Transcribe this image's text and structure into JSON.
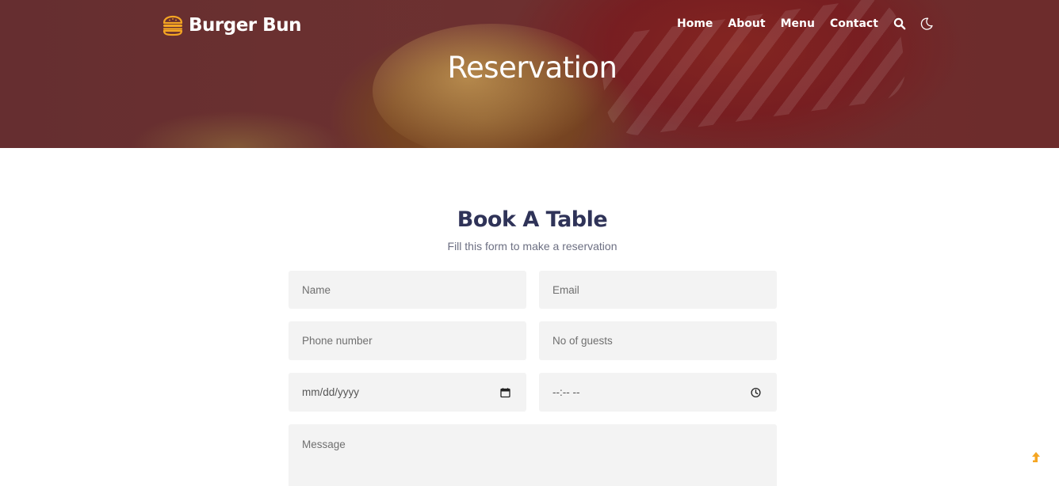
{
  "brand": {
    "name": "Burger Bun",
    "logo_icon": "burger-icon"
  },
  "nav": {
    "links": [
      "Home",
      "About",
      "Menu",
      "Contact"
    ],
    "icons": [
      "search-icon",
      "moon-icon"
    ]
  },
  "hero": {
    "title": "Reservation"
  },
  "form": {
    "title": "Book A Table",
    "subtitle": "Fill this form to make a reservation",
    "name_placeholder": "Name",
    "email_placeholder": "Email",
    "phone_placeholder": "Phone number",
    "guests_placeholder": "No of guests",
    "date_placeholder": "mm/dd/yyyy",
    "time_placeholder": "--:-- --",
    "message_placeholder": "Message"
  },
  "colors": {
    "accent": "#f5a623",
    "title": "#2f3358",
    "field_bg": "#f3f3f3"
  },
  "scroll_top_icon": "arrow-up-icon"
}
